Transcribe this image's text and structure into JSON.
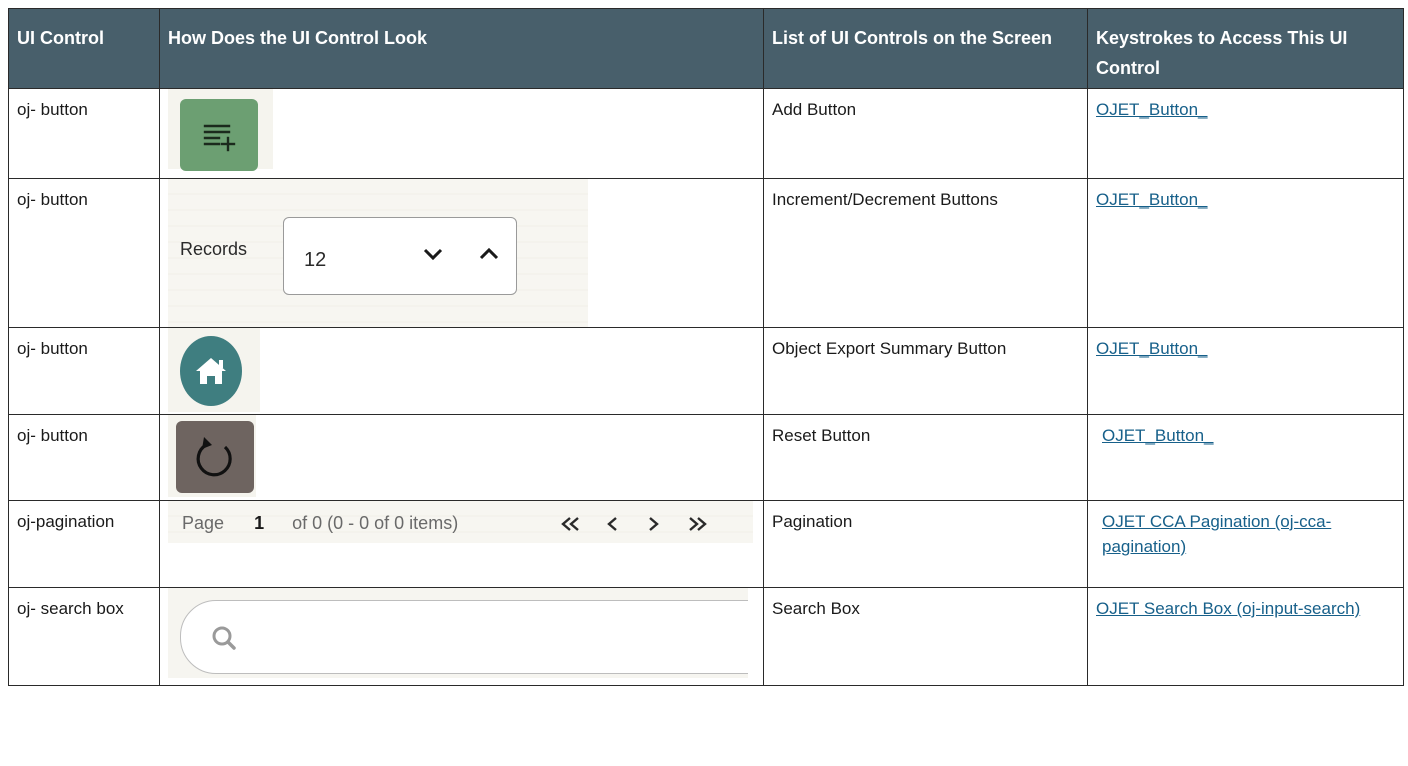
{
  "headers": [
    "UI Control",
    "How Does the UI Control Look",
    "List of UI Controls on the Screen",
    "Keystrokes to Access This UI Control"
  ],
  "rows": [
    {
      "control": "oj- button",
      "name": "Add Button",
      "link": "OJET_Button_",
      "icon": "add-list-icon"
    },
    {
      "control": "oj- button",
      "name": "Increment/Decrement Buttons",
      "link": "OJET_Button_",
      "icon": "stepper"
    },
    {
      "control": "oj- button",
      "name": "Object Export Summary Button",
      "link": "OJET_Button_",
      "icon": "home-icon"
    },
    {
      "control": "oj- button",
      "name": "Reset Button",
      "link": "OJET_Button_",
      "icon": "reset-icon"
    },
    {
      "control": "oj-pagination",
      "name": "Pagination",
      "link": "OJET CCA Pagination (oj-cca-pagination)",
      "icon": "pagination"
    },
    {
      "control": "oj- search box",
      "name": "Search Box",
      "link": "OJET Search Box (oj-input-search)",
      "icon": "search-icon"
    }
  ],
  "snippets": {
    "records_label": "Records",
    "records_value": "12",
    "page_label": "Page",
    "page_value": "1",
    "page_summary": "of 0 (0 - 0 of 0 items)"
  },
  "colors": {
    "header_bg": "#485f6b",
    "link": "#17608a",
    "add_button": "#6c9f72",
    "home_button": "#3f7e80",
    "reset_button": "#6e6460"
  }
}
